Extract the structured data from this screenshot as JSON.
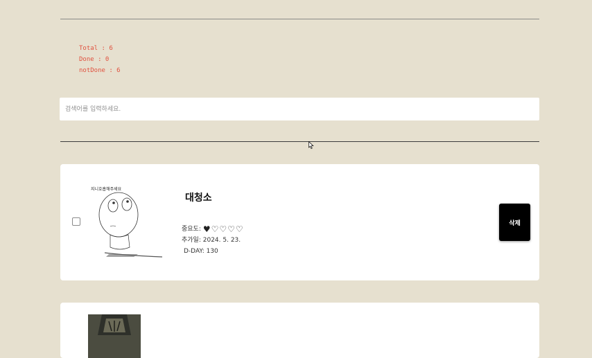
{
  "stats": {
    "total": "Total : 6",
    "done": "Done : 0",
    "not_done": "notDone : 6"
  },
  "search": {
    "placeholder": "검색어를 입력하세요.",
    "value": ""
  },
  "todos": [
    {
      "title": "대청소",
      "thumbnail_caption": "지니호흡해주세요",
      "importance_label": "중요도:",
      "importance": 1,
      "importance_max": 5,
      "hearts": "♥♡♡♡♡",
      "added_label": "추가일:",
      "added_date": "2024. 5. 23.",
      "dday": "D-DAY: 130",
      "delete_label": "삭제",
      "checked": false
    }
  ]
}
